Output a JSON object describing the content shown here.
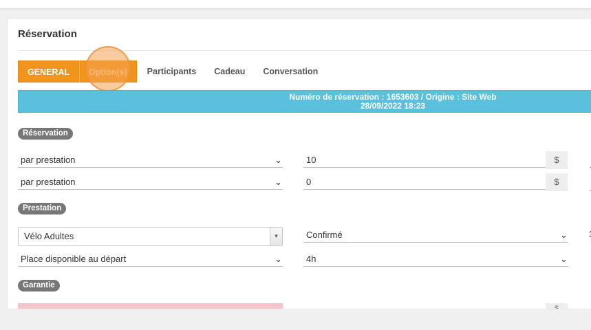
{
  "panel": {
    "title": "Réservation"
  },
  "tabs": [
    {
      "label": "GENERAL"
    },
    {
      "label": "Option(s)"
    },
    {
      "label": "Participants"
    },
    {
      "label": "Cadeau"
    },
    {
      "label": "Conversation"
    }
  ],
  "info_bar": {
    "line1": "Numéro de réservation : 1653603 / Origine : Site Web",
    "line2": "28/09/2022 18:23"
  },
  "sections": {
    "reservation": "Réservation",
    "prestation": "Prestation",
    "garantie": "Garantie"
  },
  "reservation_rows": [
    {
      "mode": "par prestation",
      "amount": "10",
      "currency": "$"
    },
    {
      "mode": "par prestation",
      "amount": "0",
      "currency": "$"
    }
  ],
  "prestation": {
    "activity": "Vélo Adultes",
    "status": "Confirmé",
    "place": "Place disponible au départ",
    "duration": "4h",
    "peek_value": "3"
  },
  "garantie": {
    "currency": "$"
  },
  "colors": {
    "accent": "#f0941e",
    "info": "#5bc0de",
    "badge": "#777777",
    "invalid": "#f6c6cc"
  }
}
